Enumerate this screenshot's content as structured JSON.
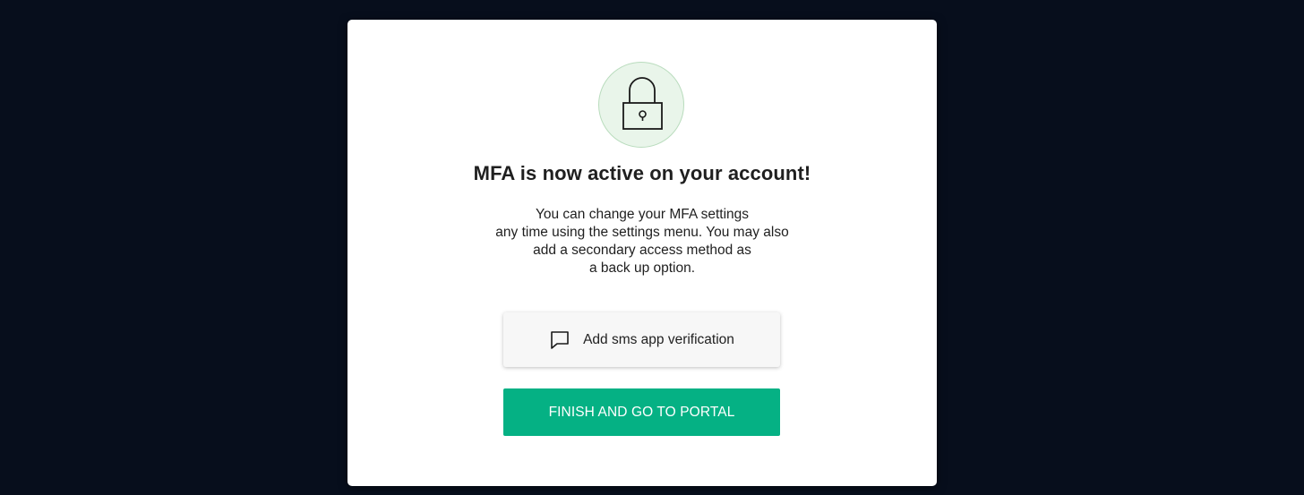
{
  "modal": {
    "lock_icon": "padlock-icon",
    "title": "MFA is now active on your account!",
    "description_lines": [
      "You can change your MFA settings",
      "any time using the settings menu. You may also",
      "add a secondary access method as",
      "a back up option."
    ],
    "sms_button": {
      "icon": "chat-bubble-icon",
      "label": "Add sms app verification"
    },
    "finish_button": {
      "label": "FINISH AND GO TO PORTAL"
    }
  },
  "colors": {
    "background": "#070e1c",
    "modal": "#ffffff",
    "lock_circle_fill": "#e9f5ea",
    "lock_circle_border": "#b9dcbd",
    "primary_button": "#05b184",
    "secondary_button": "#f7f7f7",
    "text": "#1f1f1f"
  }
}
